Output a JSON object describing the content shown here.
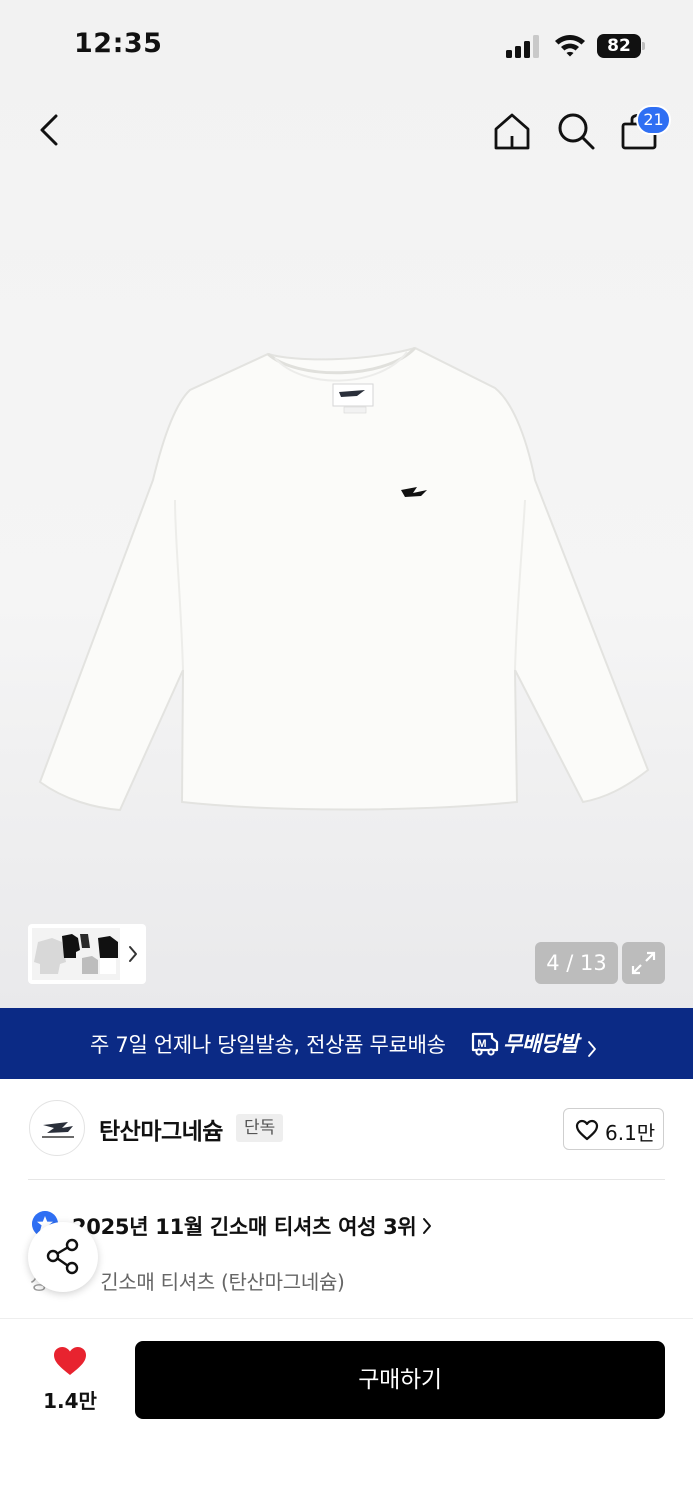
{
  "status_bar": {
    "time": "12:35",
    "battery": "82"
  },
  "nav": {
    "cart_count": "21"
  },
  "gallery": {
    "counter": "4 / 13"
  },
  "banner": {
    "text": "주 7일 언제나 당일발송, 전상품 무료배송",
    "brand": "무배당발",
    "logo_letter": "M"
  },
  "store": {
    "name": "탄산마그네슘",
    "tag": "단독",
    "likes": "6.1만"
  },
  "ranking": {
    "text": "2025년 11월 긴소매 티셔츠 여성 3위"
  },
  "category": {
    "prefix": "상",
    "path": "긴소매 티셔츠 (탄산마그네슘)"
  },
  "bottom": {
    "wish_count": "1.4만",
    "buy_label": "구매하기"
  },
  "colors": {
    "banner_bg": "#0b2a85",
    "accent_blue": "#2f6ff3",
    "heart_red": "#e8232f",
    "buy_bg": "#000000"
  },
  "icons": [
    "back-icon",
    "home-icon",
    "search-icon",
    "cart-icon",
    "expand-icon",
    "chevron-right-icon",
    "truck-icon",
    "heart-outline-icon",
    "rank-star-icon",
    "share-icon",
    "heart-filled-icon"
  ]
}
